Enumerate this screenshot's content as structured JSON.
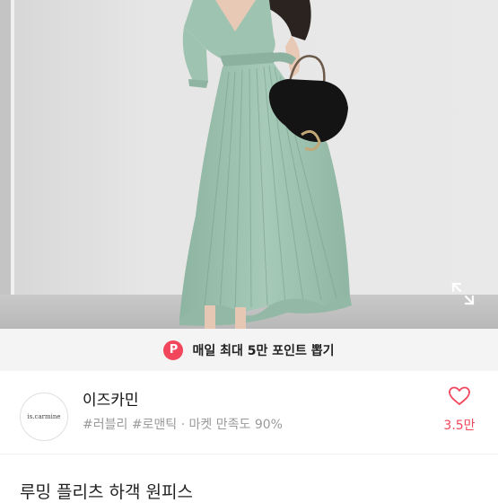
{
  "promo": {
    "badge": "P",
    "text": "매일 최대 5만 포인트 뽑기"
  },
  "store": {
    "logo_text": "is.carmine",
    "name": "이즈카민",
    "tags": "#러블리 #로맨틱 · 마켓 만족도 90%",
    "like_count": "3.5만"
  },
  "product": {
    "title": "루밍 플리츠 하객 원피스"
  },
  "colors": {
    "accent": "#f1465b",
    "dress": "#9fc3b1",
    "banner_bg": "#f4f4f4"
  },
  "icons": {
    "expand": "expand-icon",
    "heart": "heart-icon",
    "points": "points-badge"
  }
}
